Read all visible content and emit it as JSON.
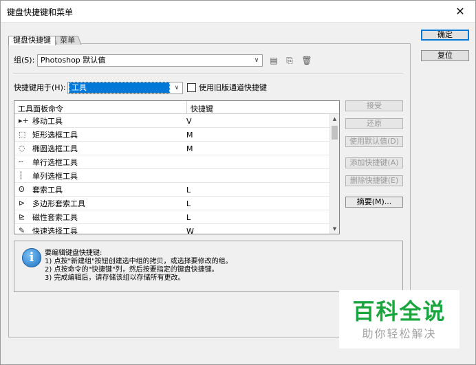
{
  "window": {
    "title": "键盘快捷键和菜单"
  },
  "tabs": [
    {
      "label": "键盘快捷键"
    },
    {
      "label": "菜单"
    }
  ],
  "group": {
    "label": "组(S):",
    "value": "Photoshop 默认值"
  },
  "shortcuts_for": {
    "label": "快捷键用于(H):",
    "value": "工具",
    "legacy_checkbox_label": "使用旧版通道快捷键"
  },
  "table": {
    "columns": [
      "工具面板命令",
      "快捷键"
    ],
    "rows": [
      {
        "icon": "move-tool-icon",
        "name": "移动工具",
        "key": "V"
      },
      {
        "icon": "rect-marquee-icon",
        "name": "矩形选框工具",
        "key": "M"
      },
      {
        "icon": "ellipse-marquee-icon",
        "name": "椭圆选框工具",
        "key": "M"
      },
      {
        "icon": "single-row-marquee-icon",
        "name": "单行选框工具",
        "key": ""
      },
      {
        "icon": "single-column-marquee-icon",
        "name": "单列选框工具",
        "key": ""
      },
      {
        "icon": "lasso-icon",
        "name": "套索工具",
        "key": "L"
      },
      {
        "icon": "polygon-lasso-icon",
        "name": "多边形套索工具",
        "key": "L"
      },
      {
        "icon": "magnetic-lasso-icon",
        "name": "磁性套索工具",
        "key": "L"
      },
      {
        "icon": "quick-select-icon",
        "name": "快速选择工具",
        "key": "W"
      }
    ]
  },
  "side_buttons": {
    "accept": "接受",
    "undo": "还原",
    "use_default": "使用默认值(D)",
    "add_shortcut": "添加快捷键(A)",
    "delete_shortcut": "删除快捷键(E)",
    "summary": "摘要(M)..."
  },
  "main_buttons": {
    "ok": "确定",
    "reset": "复位"
  },
  "info": {
    "lines": [
      "要编辑键盘快捷键:",
      "1) 点按\"新建组\"按钮创建选中组的拷贝，或选择要修改的组。",
      "2) 点按命令的\"快捷键\"列，然后按要指定的键盘快捷键。",
      "3) 完成编辑后，请存储该组以存储所有更改。"
    ]
  },
  "watermark": {
    "title": "百科全说",
    "subtitle": "助你轻松解决"
  }
}
